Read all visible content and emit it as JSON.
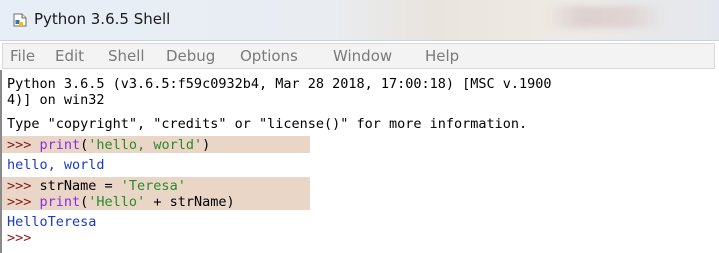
{
  "window": {
    "title": "Python 3.6.5 Shell"
  },
  "menu": [
    "File",
    "Edit",
    "Shell",
    "Debug",
    "Options",
    "Window",
    "Help"
  ],
  "shell": {
    "banner_line1": "Python 3.6.5 (v3.6.5:f59c0932b4, Mar 28 2018, 17:00:18) [MSC v.1900",
    "banner_line2": "4)] on win32",
    "banner_line3": "Type \"copyright\", \"credits\" or \"license()\" for more information.",
    "prompt": ">>> ",
    "cmd1_kw": "print",
    "cmd1_rest_open": "(",
    "cmd1_str": "'hello, world'",
    "cmd1_rest_close": ")",
    "out1": "hello, world",
    "cmd2_text": "strName = ",
    "cmd2_str": "'Teresa'",
    "cmd3_kw": "print",
    "cmd3_open": "(",
    "cmd3_str": "'Hello'",
    "cmd3_rest": " + strName)",
    "out2": "HelloTeresa",
    "last_prompt": ">>>"
  },
  "colors": {
    "prompt": "#8b1a1a",
    "keyword": "#8a2be2",
    "string": "#2a8a2a",
    "output": "#1a3ac8",
    "highlight": "#ead6c6"
  }
}
